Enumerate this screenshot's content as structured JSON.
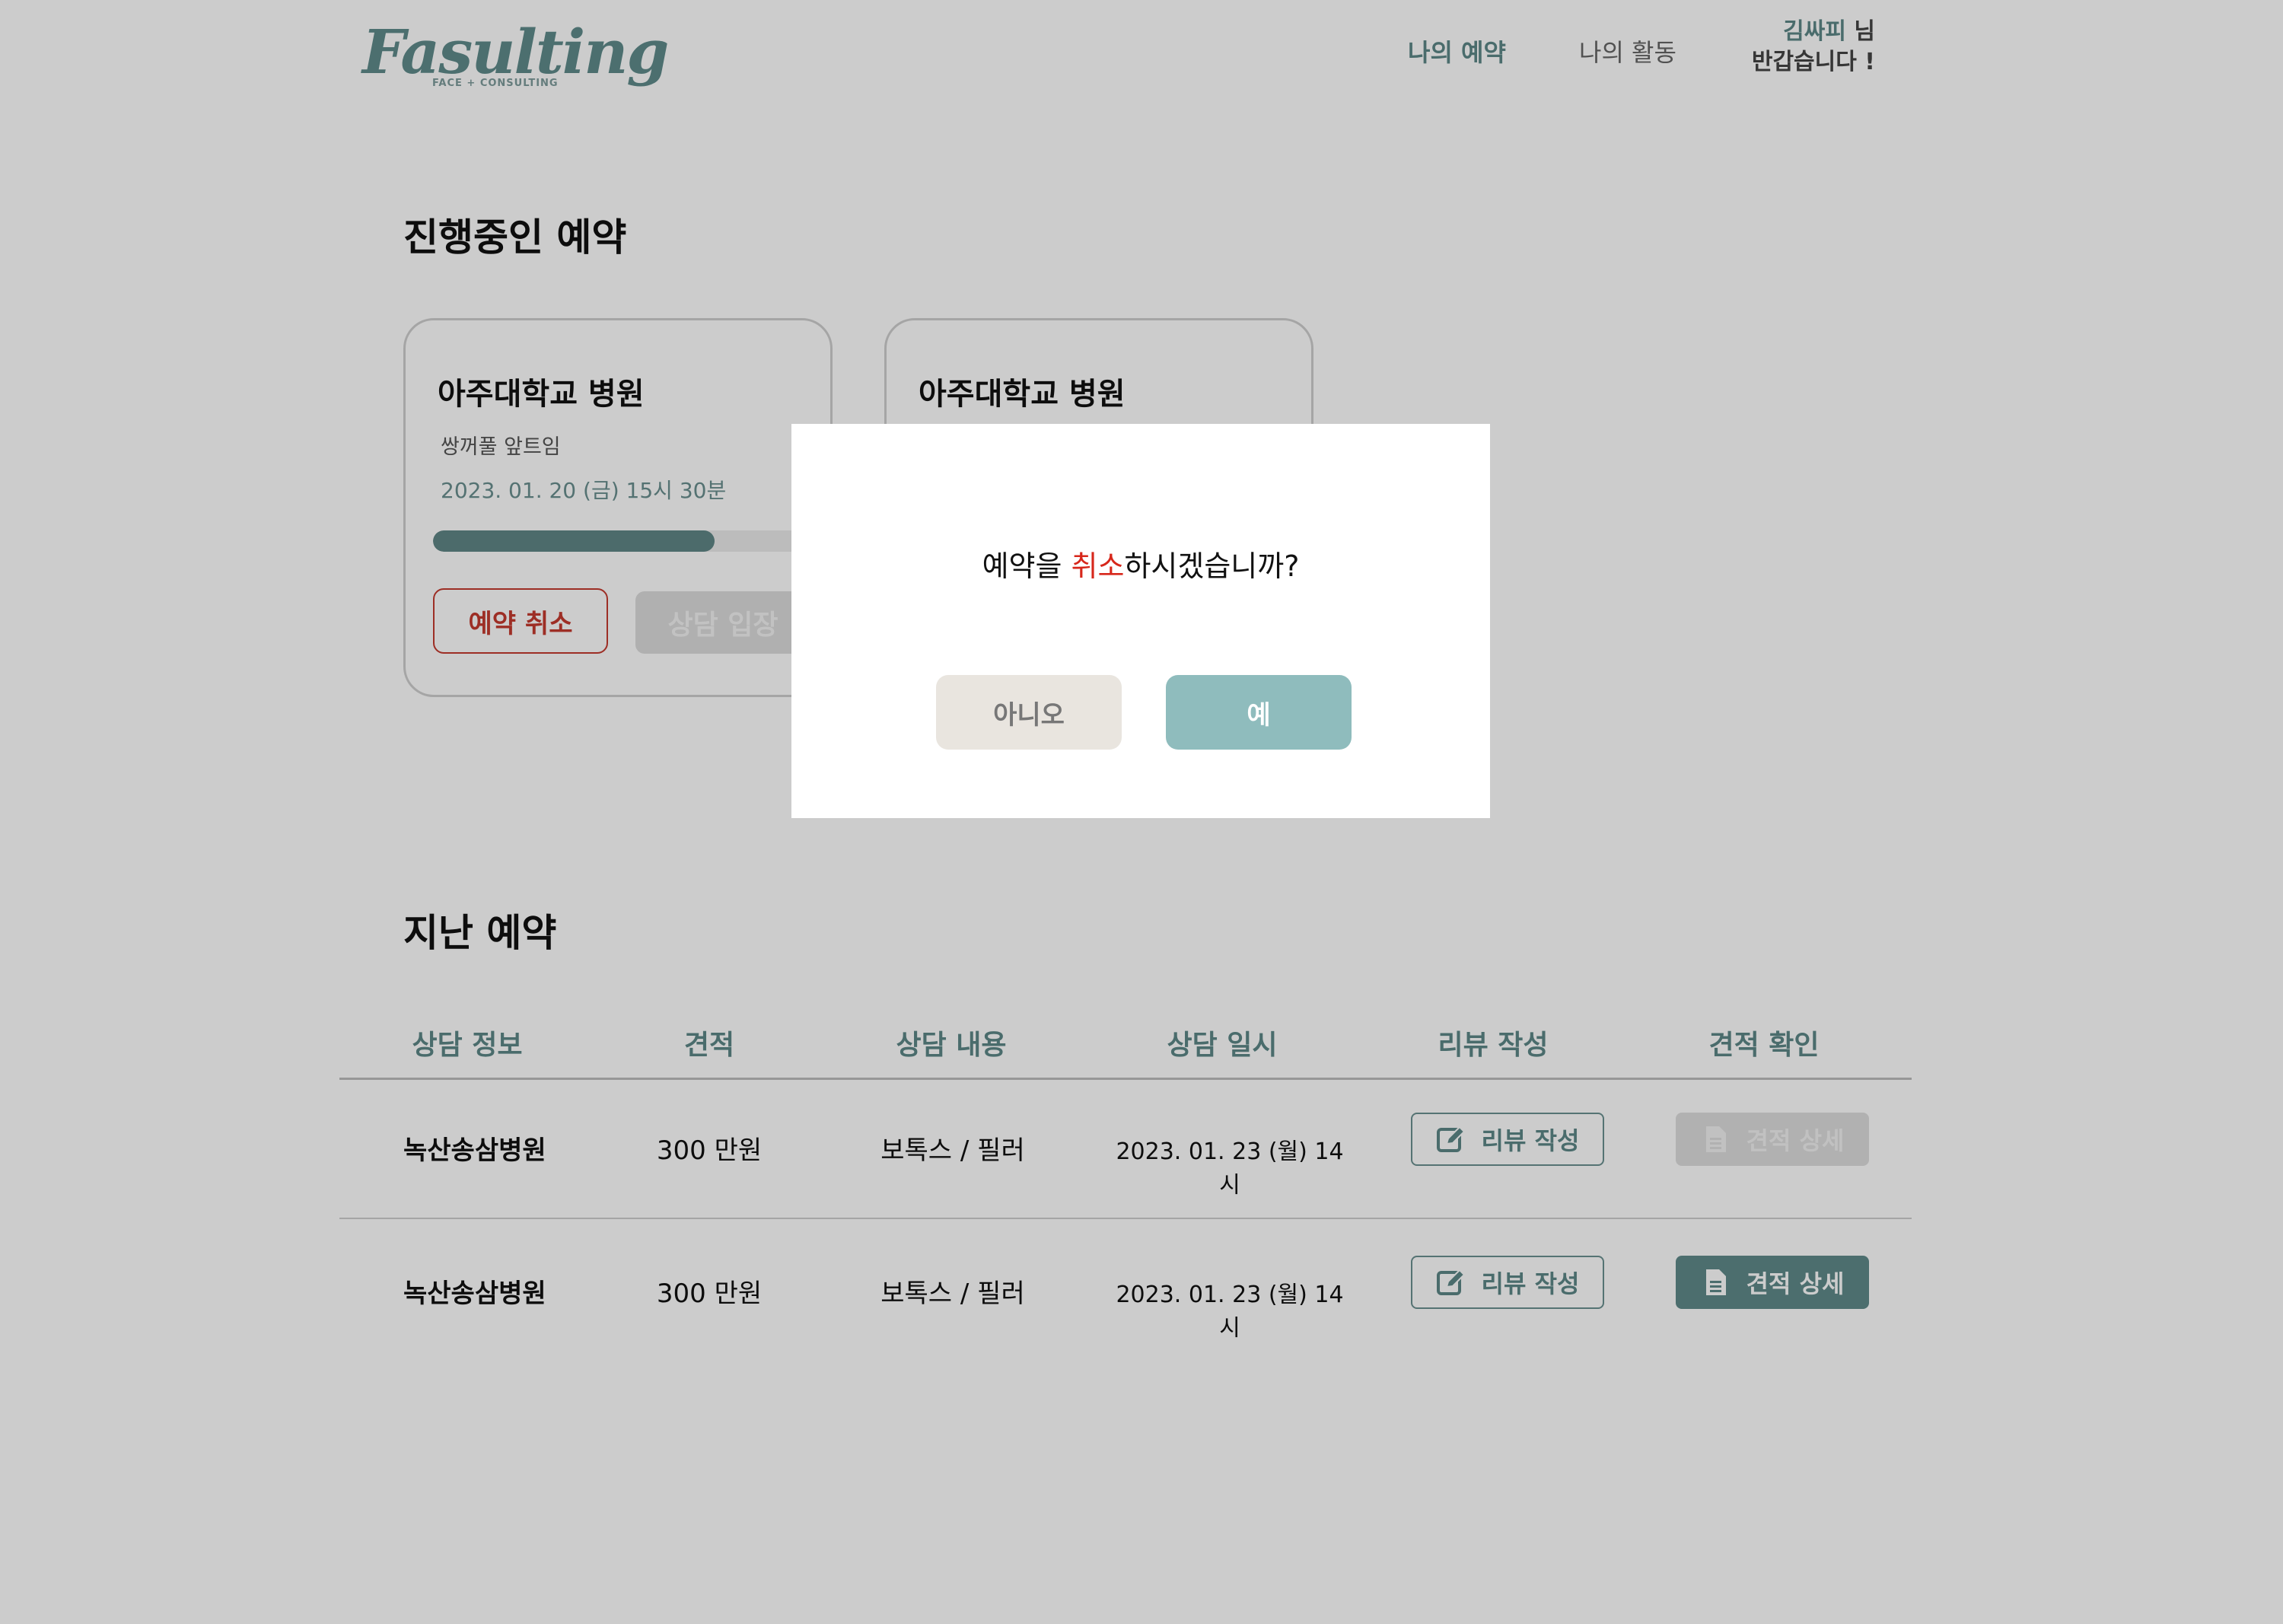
{
  "header": {
    "logo": "Fasulting",
    "logo_tagline": "FACE + CONSULTING",
    "nav": [
      "나의 예약",
      "나의 활동"
    ],
    "user_name": "김싸피",
    "user_suffix": " 님",
    "greeting_line2": "반갑습니다 !"
  },
  "ongoing": {
    "title": "진행중인 예약",
    "cards": [
      {
        "hospital": "아주대학교 병원",
        "procedure": "쌍꺼풀 앞트임",
        "datetime": "2023. 01. 20 (금) 15시 30분",
        "progress": 0.74,
        "cancel_label": "예약 취소",
        "enter_label": "상담 입장"
      },
      {
        "hospital": "아주대학교 병원",
        "procedure": "",
        "datetime": "",
        "progress": 0,
        "cancel_label": "",
        "enter_label": ""
      }
    ]
  },
  "past": {
    "title": "지난 예약",
    "columns": [
      "상담 정보",
      "견적",
      "상담 내용",
      "상담 일시",
      "리뷰 작성",
      "견적 확인"
    ],
    "rows": [
      {
        "hospital": "녹산송삼병원",
        "price": "300 만원",
        "content": "보톡스 / 필러",
        "datetime": "2023. 01. 23 (월) 14시",
        "review_label": "리뷰 작성",
        "quote_label": "견적 상세",
        "quote_enabled": false
      },
      {
        "hospital": "녹산송삼병원",
        "price": "300 만원",
        "content": "보톡스 / 필러",
        "datetime": "2023. 01. 23 (월) 14시",
        "review_label": "리뷰 작성",
        "quote_label": "견적 상세",
        "quote_enabled": true
      }
    ]
  },
  "modal": {
    "message_before": "예약을 ",
    "message_accent": "취소",
    "message_after": "하시겠습니까?",
    "no_label": "아니오",
    "yes_label": "예"
  },
  "colors": {
    "brand": "#5f8b8b",
    "accent_red": "#d7271b",
    "cancel_border": "#c53a2f",
    "yes_button": "#8fbcbd",
    "no_button": "#e9e5df"
  }
}
